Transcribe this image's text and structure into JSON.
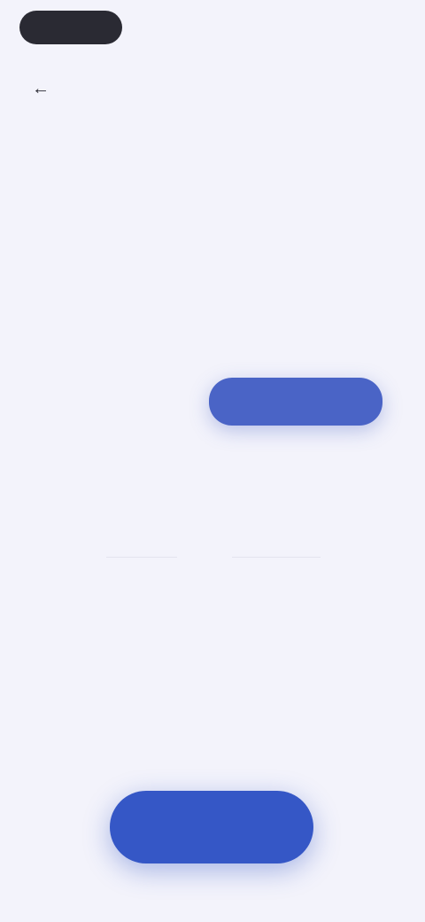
{
  "status_bar": {
    "left_pill": "",
    "center": "",
    "right": ""
  },
  "nav": {
    "back_icon": "arrow-left-icon",
    "step": ""
  },
  "headline": "",
  "subtext": "",
  "options": [
    {
      "label": "",
      "selected": false
    },
    {
      "label": "",
      "selected": true
    },
    {
      "label": "",
      "selected": false
    },
    {
      "label": "",
      "selected": false
    },
    {
      "label": "",
      "selected": false
    },
    {
      "label": "",
      "selected": false
    },
    {
      "label": "",
      "selected": false
    }
  ],
  "cta_label": "",
  "colors": {
    "background": "#f3f3fb",
    "accent": "#3557c6",
    "selected_chip": "#4a64c6",
    "text": "#2a2a33"
  }
}
